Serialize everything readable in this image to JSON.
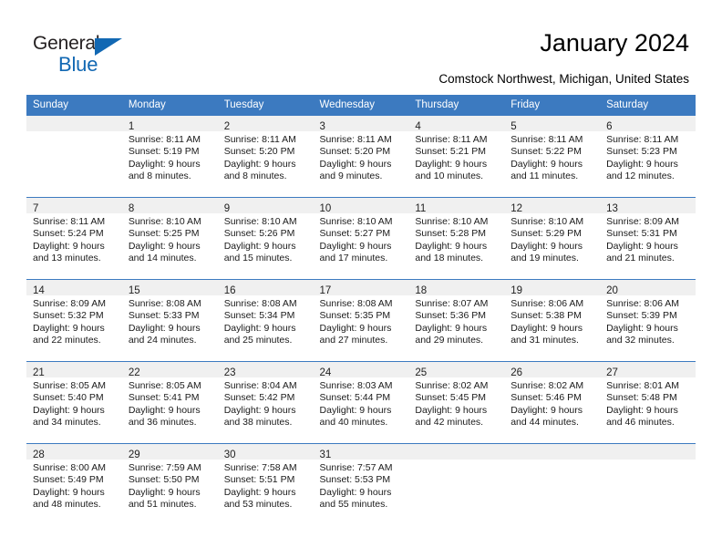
{
  "brand": {
    "name_top": "General",
    "name_bottom": "Blue",
    "accent_color": "#1268b3"
  },
  "header": {
    "title": "January 2024",
    "subtitle": "Comstock Northwest, Michigan, United States"
  },
  "theme": {
    "header_blue": "#3c7ac0",
    "band_gray": "#f0f0f0"
  },
  "calendar": {
    "weekday_headers": [
      "Sunday",
      "Monday",
      "Tuesday",
      "Wednesday",
      "Thursday",
      "Friday",
      "Saturday"
    ],
    "weeks": [
      [
        {
          "day": "",
          "lines": []
        },
        {
          "day": "1",
          "lines": [
            "Sunrise: 8:11 AM",
            "Sunset: 5:19 PM",
            "Daylight: 9 hours",
            "and 8 minutes."
          ]
        },
        {
          "day": "2",
          "lines": [
            "Sunrise: 8:11 AM",
            "Sunset: 5:20 PM",
            "Daylight: 9 hours",
            "and 8 minutes."
          ]
        },
        {
          "day": "3",
          "lines": [
            "Sunrise: 8:11 AM",
            "Sunset: 5:20 PM",
            "Daylight: 9 hours",
            "and 9 minutes."
          ]
        },
        {
          "day": "4",
          "lines": [
            "Sunrise: 8:11 AM",
            "Sunset: 5:21 PM",
            "Daylight: 9 hours",
            "and 10 minutes."
          ]
        },
        {
          "day": "5",
          "lines": [
            "Sunrise: 8:11 AM",
            "Sunset: 5:22 PM",
            "Daylight: 9 hours",
            "and 11 minutes."
          ]
        },
        {
          "day": "6",
          "lines": [
            "Sunrise: 8:11 AM",
            "Sunset: 5:23 PM",
            "Daylight: 9 hours",
            "and 12 minutes."
          ]
        }
      ],
      [
        {
          "day": "7",
          "lines": [
            "Sunrise: 8:11 AM",
            "Sunset: 5:24 PM",
            "Daylight: 9 hours",
            "and 13 minutes."
          ]
        },
        {
          "day": "8",
          "lines": [
            "Sunrise: 8:10 AM",
            "Sunset: 5:25 PM",
            "Daylight: 9 hours",
            "and 14 minutes."
          ]
        },
        {
          "day": "9",
          "lines": [
            "Sunrise: 8:10 AM",
            "Sunset: 5:26 PM",
            "Daylight: 9 hours",
            "and 15 minutes."
          ]
        },
        {
          "day": "10",
          "lines": [
            "Sunrise: 8:10 AM",
            "Sunset: 5:27 PM",
            "Daylight: 9 hours",
            "and 17 minutes."
          ]
        },
        {
          "day": "11",
          "lines": [
            "Sunrise: 8:10 AM",
            "Sunset: 5:28 PM",
            "Daylight: 9 hours",
            "and 18 minutes."
          ]
        },
        {
          "day": "12",
          "lines": [
            "Sunrise: 8:10 AM",
            "Sunset: 5:29 PM",
            "Daylight: 9 hours",
            "and 19 minutes."
          ]
        },
        {
          "day": "13",
          "lines": [
            "Sunrise: 8:09 AM",
            "Sunset: 5:31 PM",
            "Daylight: 9 hours",
            "and 21 minutes."
          ]
        }
      ],
      [
        {
          "day": "14",
          "lines": [
            "Sunrise: 8:09 AM",
            "Sunset: 5:32 PM",
            "Daylight: 9 hours",
            "and 22 minutes."
          ]
        },
        {
          "day": "15",
          "lines": [
            "Sunrise: 8:08 AM",
            "Sunset: 5:33 PM",
            "Daylight: 9 hours",
            "and 24 minutes."
          ]
        },
        {
          "day": "16",
          "lines": [
            "Sunrise: 8:08 AM",
            "Sunset: 5:34 PM",
            "Daylight: 9 hours",
            "and 25 minutes."
          ]
        },
        {
          "day": "17",
          "lines": [
            "Sunrise: 8:08 AM",
            "Sunset: 5:35 PM",
            "Daylight: 9 hours",
            "and 27 minutes."
          ]
        },
        {
          "day": "18",
          "lines": [
            "Sunrise: 8:07 AM",
            "Sunset: 5:36 PM",
            "Daylight: 9 hours",
            "and 29 minutes."
          ]
        },
        {
          "day": "19",
          "lines": [
            "Sunrise: 8:06 AM",
            "Sunset: 5:38 PM",
            "Daylight: 9 hours",
            "and 31 minutes."
          ]
        },
        {
          "day": "20",
          "lines": [
            "Sunrise: 8:06 AM",
            "Sunset: 5:39 PM",
            "Daylight: 9 hours",
            "and 32 minutes."
          ]
        }
      ],
      [
        {
          "day": "21",
          "lines": [
            "Sunrise: 8:05 AM",
            "Sunset: 5:40 PM",
            "Daylight: 9 hours",
            "and 34 minutes."
          ]
        },
        {
          "day": "22",
          "lines": [
            "Sunrise: 8:05 AM",
            "Sunset: 5:41 PM",
            "Daylight: 9 hours",
            "and 36 minutes."
          ]
        },
        {
          "day": "23",
          "lines": [
            "Sunrise: 8:04 AM",
            "Sunset: 5:42 PM",
            "Daylight: 9 hours",
            "and 38 minutes."
          ]
        },
        {
          "day": "24",
          "lines": [
            "Sunrise: 8:03 AM",
            "Sunset: 5:44 PM",
            "Daylight: 9 hours",
            "and 40 minutes."
          ]
        },
        {
          "day": "25",
          "lines": [
            "Sunrise: 8:02 AM",
            "Sunset: 5:45 PM",
            "Daylight: 9 hours",
            "and 42 minutes."
          ]
        },
        {
          "day": "26",
          "lines": [
            "Sunrise: 8:02 AM",
            "Sunset: 5:46 PM",
            "Daylight: 9 hours",
            "and 44 minutes."
          ]
        },
        {
          "day": "27",
          "lines": [
            "Sunrise: 8:01 AM",
            "Sunset: 5:48 PM",
            "Daylight: 9 hours",
            "and 46 minutes."
          ]
        }
      ],
      [
        {
          "day": "28",
          "lines": [
            "Sunrise: 8:00 AM",
            "Sunset: 5:49 PM",
            "Daylight: 9 hours",
            "and 48 minutes."
          ]
        },
        {
          "day": "29",
          "lines": [
            "Sunrise: 7:59 AM",
            "Sunset: 5:50 PM",
            "Daylight: 9 hours",
            "and 51 minutes."
          ]
        },
        {
          "day": "30",
          "lines": [
            "Sunrise: 7:58 AM",
            "Sunset: 5:51 PM",
            "Daylight: 9 hours",
            "and 53 minutes."
          ]
        },
        {
          "day": "31",
          "lines": [
            "Sunrise: 7:57 AM",
            "Sunset: 5:53 PM",
            "Daylight: 9 hours",
            "and 55 minutes."
          ]
        },
        {
          "day": "",
          "lines": []
        },
        {
          "day": "",
          "lines": []
        },
        {
          "day": "",
          "lines": []
        }
      ]
    ]
  }
}
